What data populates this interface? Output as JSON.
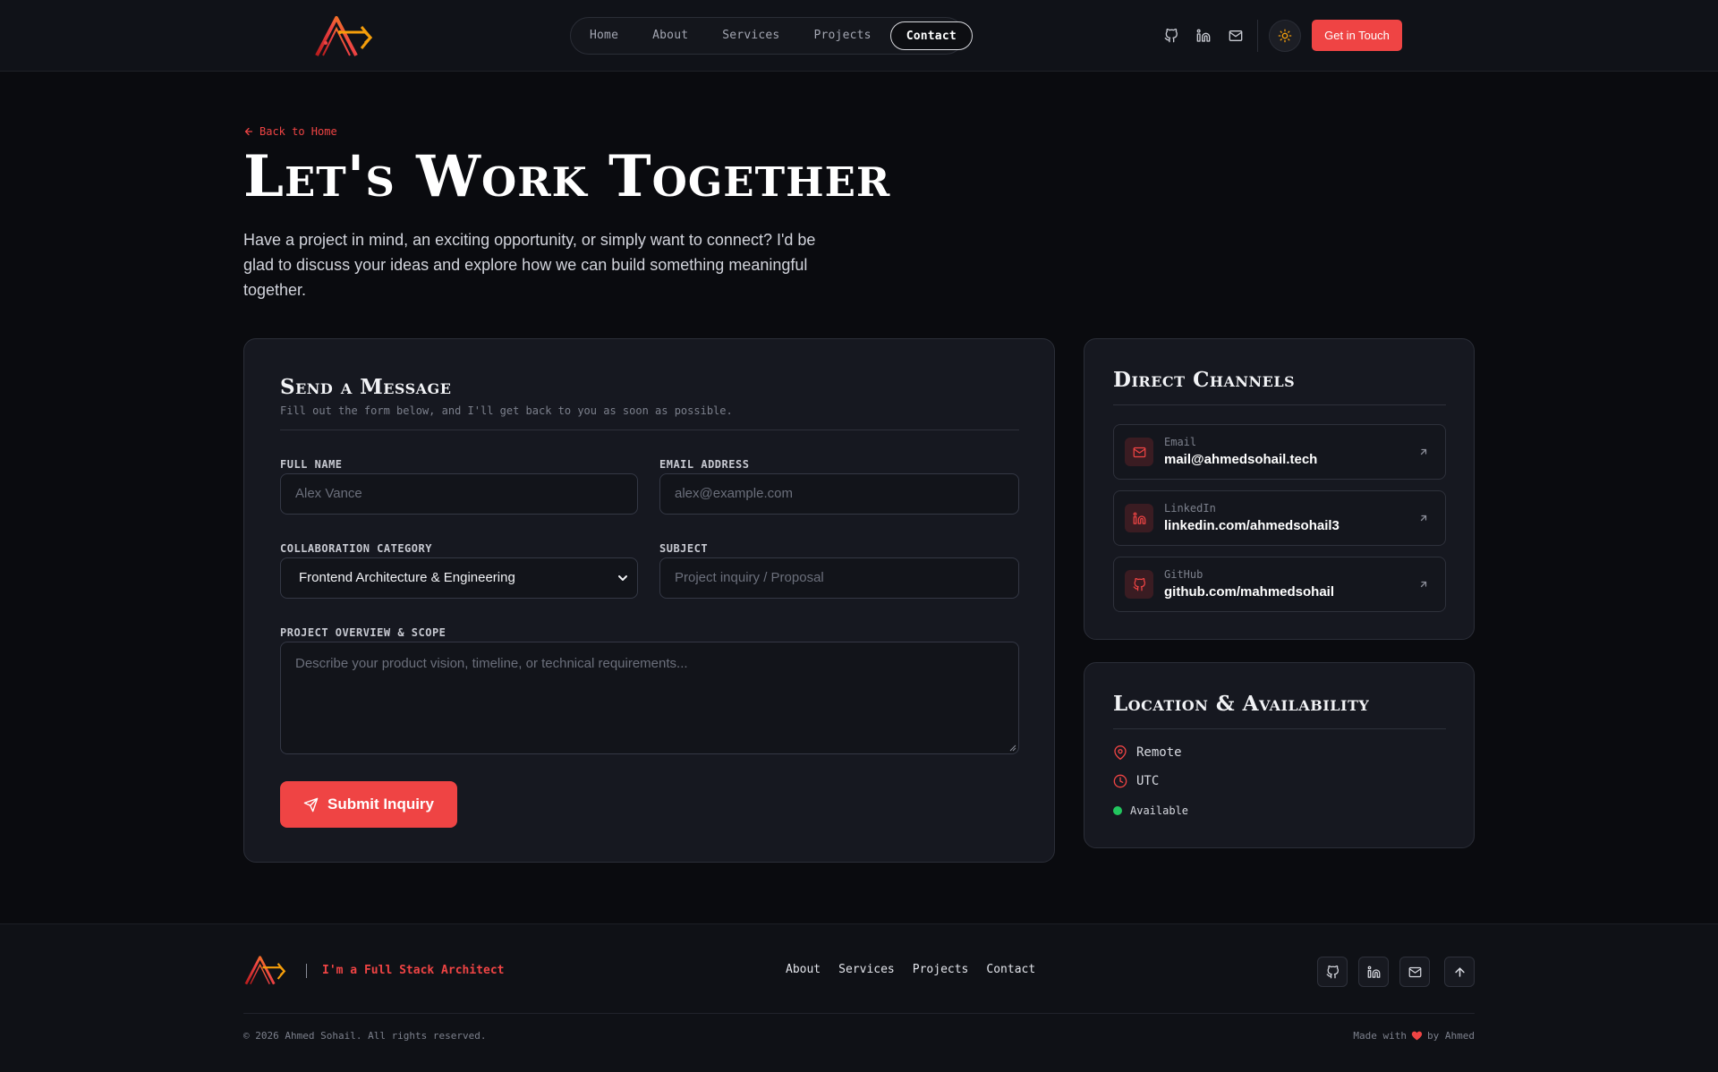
{
  "header": {
    "nav": [
      "Home",
      "About",
      "Services",
      "Projects",
      "Contact"
    ],
    "active_nav": "Contact",
    "icons": [
      "github-icon",
      "linkedin-icon",
      "mail-icon"
    ],
    "theme_icon": "sun-icon",
    "cta_label": "Get in Touch"
  },
  "hero": {
    "back_label": "Back to Home",
    "title": "Let's Work Together",
    "intro": "Have a project in mind, an exciting opportunity, or simply want to connect? I'd be glad to discuss your ideas and explore how we can build something meaningful together."
  },
  "form": {
    "title": "Send a Message",
    "subtitle": "Fill out the form below, and I'll get back to you as soon as possible.",
    "name_label": "FULL NAME",
    "name_placeholder": "Alex Vance",
    "email_label": "EMAIL ADDRESS",
    "email_placeholder": "alex@example.com",
    "category_label": "COLLABORATION CATEGORY",
    "category_value": "Frontend Architecture & Engineering",
    "subject_label": "SUBJECT",
    "subject_placeholder": "Project inquiry / Proposal",
    "overview_label": "PROJECT OVERVIEW & SCOPE",
    "overview_placeholder": "Describe your product vision, timeline, or technical requirements...",
    "submit_label": "Submit Inquiry"
  },
  "channels": {
    "title": "Direct Channels",
    "items": [
      {
        "type": "Email",
        "value": "mail@ahmedsohail.tech",
        "icon": "mail-icon"
      },
      {
        "type": "LinkedIn",
        "value": "linkedin.com/ahmedsohail3",
        "icon": "linkedin-icon"
      },
      {
        "type": "GitHub",
        "value": "github.com/mahmedsohail",
        "icon": "github-icon"
      }
    ]
  },
  "location": {
    "title": "Location & Availability",
    "place": "Remote",
    "timezone": "UTC",
    "status": "Available"
  },
  "footer": {
    "tagline": "I'm a Full Stack Architect",
    "nav": [
      "About",
      "Services",
      "Projects",
      "Contact"
    ],
    "copyright": "© 2026 Ahmed Sohail. All rights reserved.",
    "made_prefix": "Made with",
    "made_suffix": "by Ahmed"
  },
  "colors": {
    "accent": "#ef4444",
    "background": "#0a0b0f",
    "card": "#161820",
    "status": "#22c55e"
  }
}
